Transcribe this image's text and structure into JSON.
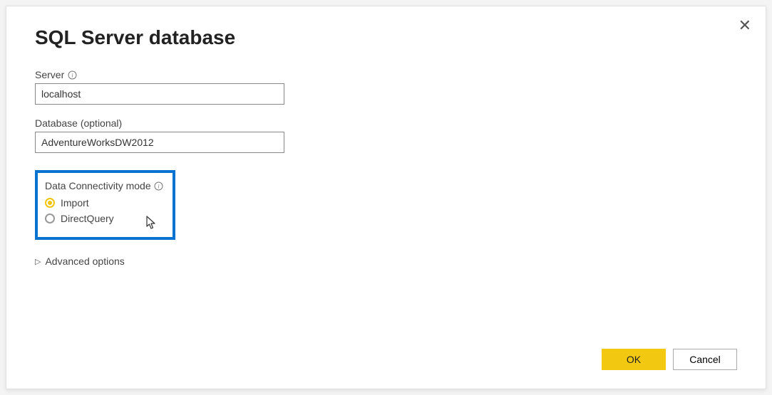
{
  "dialog": {
    "title": "SQL Server database",
    "close_tooltip": "Close"
  },
  "fields": {
    "server_label": "Server",
    "server_value": "localhost",
    "database_label": "Database (optional)",
    "database_value": "AdventureWorksDW2012"
  },
  "connectivity": {
    "section_label": "Data Connectivity mode",
    "options": {
      "import": "Import",
      "directquery": "DirectQuery"
    },
    "selected": "import"
  },
  "advanced": {
    "toggle_label": "Advanced options"
  },
  "buttons": {
    "ok": "OK",
    "cancel": "Cancel"
  }
}
